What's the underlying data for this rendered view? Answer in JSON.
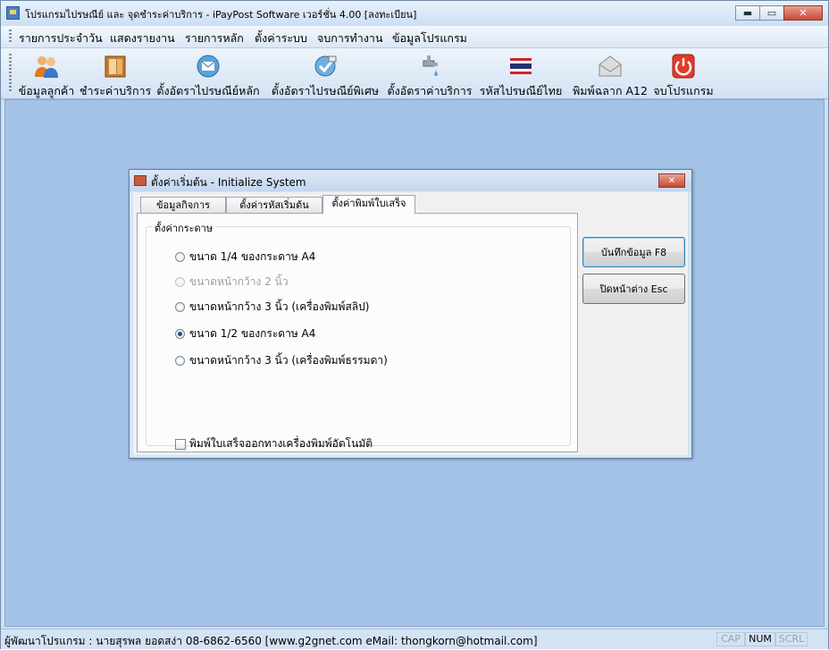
{
  "window": {
    "title": "โปรแกรมไปรษณีย์ และ จุดชำระค่าบริการ - iPayPost Software เวอร์ชั่น 4.00 [ลงทะเบียน]",
    "minimize_glyph": "▬",
    "maximize_glyph": "▭",
    "close_glyph": "✕"
  },
  "menu": {
    "items": [
      "รายการประจำวัน",
      "แสดงรายงาน",
      "รายการหลัก",
      "ตั้งค่าระบบ",
      "จบการทำงาน",
      "ข้อมูลโปรแกรม"
    ]
  },
  "toolbar": {
    "items": [
      {
        "label": "ข้อมูลลูกค้า",
        "icon": "customers-icon"
      },
      {
        "label": "ชำระค่าบริการ",
        "icon": "payment-book-icon"
      },
      {
        "label": "ตั้งอัตราไปรษณีย์หลัก",
        "icon": "mail-rate-icon"
      },
      {
        "label": "ตั้งอัตราไปรษณีย์พิเศษ",
        "icon": "special-rate-icon"
      },
      {
        "label": "ตั้งอัตราค่าบริการ",
        "icon": "service-rate-icon"
      },
      {
        "label": "รหัสไปรษณีย์ไทย",
        "icon": "thai-flag-icon"
      },
      {
        "label": "พิมพ์ฉลาก A12",
        "icon": "envelope-icon"
      },
      {
        "label": "จบโปรแกรม",
        "icon": "power-icon"
      }
    ]
  },
  "dialog": {
    "title": "ตั้งค่าเริ่มต้น - Initialize System",
    "close_glyph": "✕",
    "tabs": [
      "ข้อมูลกิจการ",
      "ตั้งค่ารหัสเริ่มต้น",
      "ตั้งค่าพิมพ์ใบเสร็จ"
    ],
    "active_tab": 2,
    "group_label": "ตั้งค่ากระดาษ",
    "radios": [
      {
        "label": "ขนาด 1/4 ของกระดาษ A4",
        "checked": false,
        "enabled": true
      },
      {
        "label": "ขนาดหน้ากว้าง 2 นิ้ว",
        "checked": false,
        "enabled": false
      },
      {
        "label": "ขนาดหน้ากว้าง 3 นิ้ว (เครื่องพิมพ์สลิป)",
        "checked": false,
        "enabled": true
      },
      {
        "label": "ขนาด 1/2 ของกระดาษ A4",
        "checked": true,
        "enabled": true
      },
      {
        "label": "ขนาดหน้ากว้าง 3 นิ้ว (เครื่องพิมพ์ธรรมดา)",
        "checked": false,
        "enabled": true
      }
    ],
    "checkbox": {
      "label": "พิมพ์ใบเสร็จออกทางเครื่องพิมพ์อัตโนมัติ",
      "checked": false
    },
    "save_button": "บันทึกข้อมูล F8",
    "close_button": "ปิดหน้าต่าง Esc"
  },
  "statusbar": {
    "text": "ผู้พัฒนาโปรแกรม : นายสุรพล ยอดสง่า 08-6862-6560  [www.g2gnet.com  eMail: thongkorn@hotmail.com]",
    "cap": "CAP",
    "num": "NUM",
    "scrl": "SCRL"
  }
}
